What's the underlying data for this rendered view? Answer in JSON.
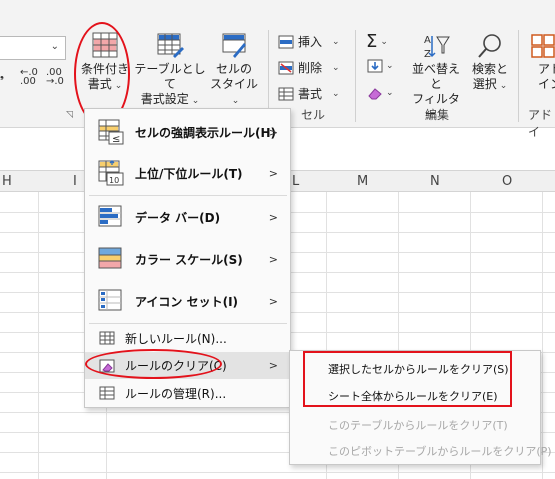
{
  "ribbon": {
    "number_group": {
      "decimal_increase": "←.0\n.00",
      "decimal_decrease": ".00\n→.0",
      "comma": "9"
    },
    "styles_group": {
      "conditional_formatting": {
        "line1": "条件付き",
        "line2": "書式"
      },
      "format_as_table": {
        "line1": "テーブルとして",
        "line2": "書式設定"
      },
      "cell_styles": {
        "line1": "セルの",
        "line2": "スタイル"
      }
    },
    "cells_group": {
      "insert": "挿入",
      "delete": "削除",
      "format": "書式",
      "label": "セル"
    },
    "editing_group": {
      "sort_filter": {
        "line1": "並べ替えと",
        "line2": "フィルター"
      },
      "find_select": {
        "line1": "検索と",
        "line2": "選択"
      },
      "label": "編集"
    },
    "addins": {
      "line1": "アド",
      "line2": "イン",
      "label": "アドイ"
    }
  },
  "sheet": {
    "columns": [
      "H",
      "I",
      "L",
      "M",
      "N",
      "O"
    ]
  },
  "menu": {
    "items": [
      {
        "label": "セルの強調表示ルール(H)",
        "has_sub": true
      },
      {
        "label": "上位/下位ルール(T)",
        "has_sub": true
      },
      {
        "label": "データ バー(D)",
        "has_sub": true
      },
      {
        "label": "カラー スケール(S)",
        "has_sub": true
      },
      {
        "label": "アイコン セット(I)",
        "has_sub": true
      },
      {
        "label": "新しいルール(N)..."
      },
      {
        "label": "ルールのクリア(C)",
        "has_sub": true
      },
      {
        "label": "ルールの管理(R)..."
      }
    ],
    "submenu_arrow": ">"
  },
  "submenu": {
    "items": [
      {
        "label": "選択したセルからルールをクリア(S)",
        "enabled": true
      },
      {
        "label": "シート全体からルールをクリア(E)",
        "enabled": true
      },
      {
        "label": "このテーブルからルールをクリア(T)",
        "enabled": false
      },
      {
        "label": "このピボットテーブルからルールをクリア(P)",
        "enabled": false
      }
    ]
  },
  "colors": {
    "annotation_red": "#e3121b",
    "accent_blue": "#2b6cc4",
    "highlight": "#e3e3e3"
  }
}
